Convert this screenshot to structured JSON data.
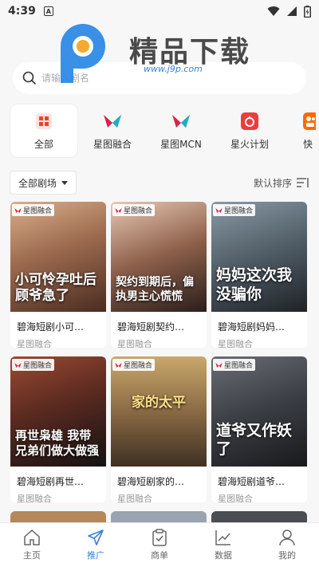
{
  "statusbar": {
    "time": "4:39",
    "app_badge": "A"
  },
  "watermark": {
    "brand": "精品下载",
    "url": "www.j9p.com"
  },
  "search": {
    "placeholder": "请输入剧名"
  },
  "categories": [
    {
      "label": "全部",
      "icon": "grid-icon",
      "color": "#e8452c"
    },
    {
      "label": "星图融合",
      "icon": "xingtu-icon",
      "color": "#d6244a"
    },
    {
      "label": "星图MCN",
      "icon": "xingtu-mcn-icon",
      "color": "#d6244a"
    },
    {
      "label": "星火计划",
      "icon": "flame-icon",
      "color": "#ef3b3b"
    },
    {
      "label": "快",
      "icon": "kuaishou-icon",
      "color": "#ff6a00"
    }
  ],
  "filters": {
    "dropdown_label": "全部剧场",
    "sort_label": "默认排序"
  },
  "badge_label": "星图融合",
  "cards": [
    {
      "title": "碧海短剧小可…",
      "sub": "星图融合",
      "poster_text": "小可怜孕吐后顾爷急了",
      "bg": [
        "#b78a6a",
        "#5a3b2b"
      ]
    },
    {
      "title": "碧海短剧契约…",
      "sub": "星图融合",
      "poster_text": "契约到期后，偏执男主心慌慌",
      "bg": [
        "#c9a38a",
        "#3b2a24"
      ]
    },
    {
      "title": "碧海短剧妈妈…",
      "sub": "星图融合",
      "poster_text": "妈妈这次我没骗你",
      "bg": [
        "#5c6e7a",
        "#2a2d33"
      ]
    },
    {
      "title": "碧海短剧再世…",
      "sub": "星图融合",
      "poster_text": "再世枭雄 我带兄弟们做大做强",
      "bg": [
        "#7a3c2a",
        "#1e1a1a"
      ]
    },
    {
      "title": "碧海短剧家的…",
      "sub": "星图融合",
      "poster_text": "家的太平",
      "bg": [
        "#a88a5c",
        "#4a3a2a"
      ]
    },
    {
      "title": "碧海短剧道爷…",
      "sub": "星图融合",
      "poster_text": "道爷又作妖了",
      "bg": [
        "#4c5056",
        "#1e2024"
      ]
    }
  ],
  "tabbar": [
    {
      "label": "主页",
      "icon": "home-icon",
      "active": false
    },
    {
      "label": "推广",
      "icon": "send-icon",
      "active": true
    },
    {
      "label": "商单",
      "icon": "clipboard-icon",
      "active": false
    },
    {
      "label": "数据",
      "icon": "chart-icon",
      "active": false
    },
    {
      "label": "我的",
      "icon": "user-icon",
      "active": false
    }
  ],
  "colors": {
    "accent": "#3b7de0",
    "background": "#f7f7f7"
  }
}
